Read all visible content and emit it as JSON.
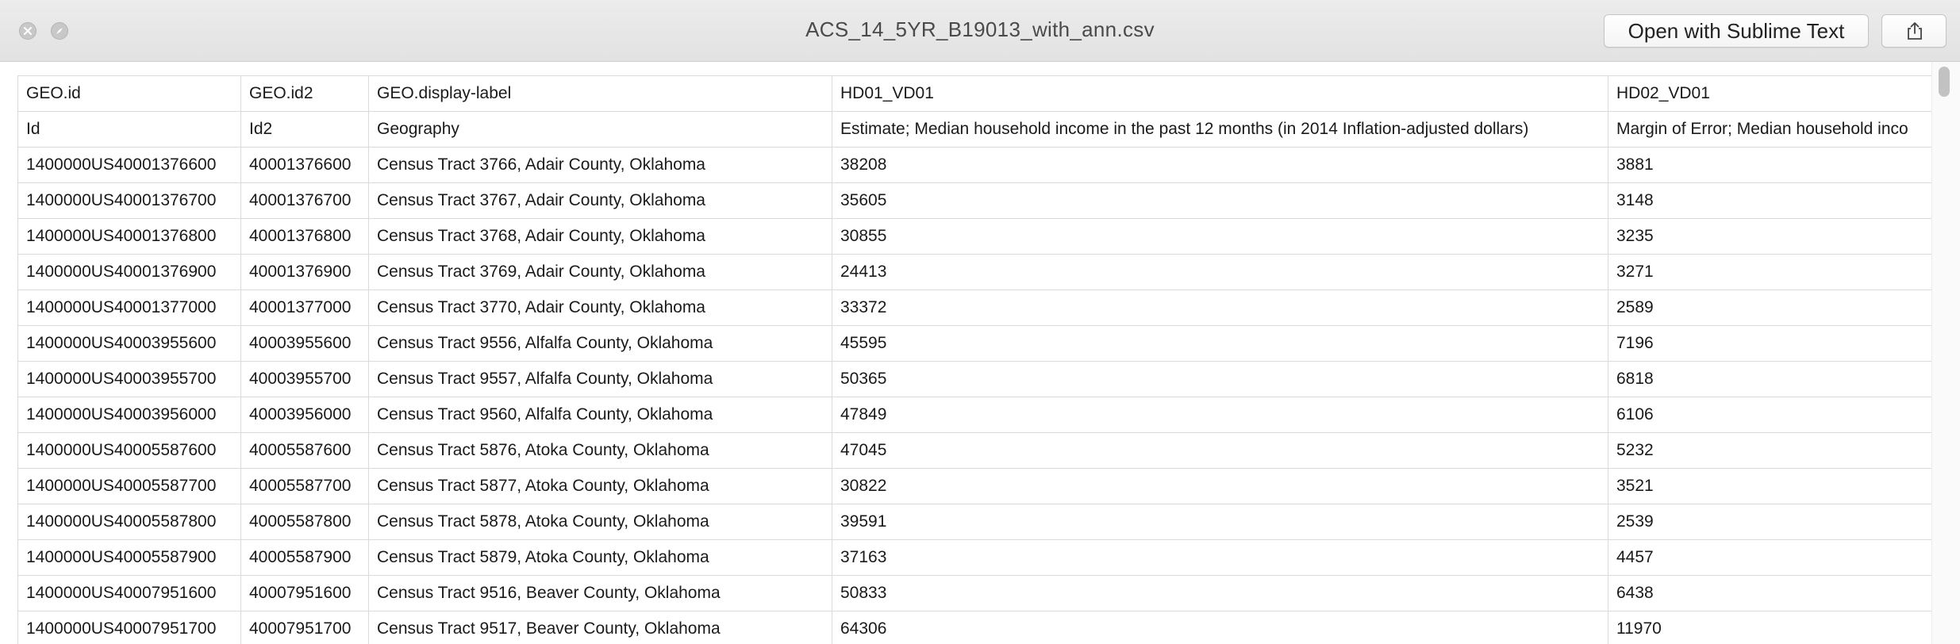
{
  "window": {
    "title": "ACS_14_5YR_B19013_with_ann.csv",
    "open_button_label": "Open with Sublime Text"
  },
  "icons": {
    "close": "close-icon",
    "fullscreen": "fullscreen-icon",
    "share": "share-icon"
  },
  "table": {
    "rows": [
      [
        "GEO.id",
        "GEO.id2",
        "GEO.display-label",
        "HD01_VD01",
        "HD02_VD01"
      ],
      [
        "Id",
        "Id2",
        "Geography",
        "Estimate; Median household income in the past 12 months (in 2014 Inflation-adjusted dollars)",
        "Margin of Error; Median household inco"
      ],
      [
        "1400000US40001376600",
        "40001376600",
        "Census Tract 3766, Adair County, Oklahoma",
        "38208",
        "3881"
      ],
      [
        "1400000US40001376700",
        "40001376700",
        "Census Tract 3767, Adair County, Oklahoma",
        "35605",
        "3148"
      ],
      [
        "1400000US40001376800",
        "40001376800",
        "Census Tract 3768, Adair County, Oklahoma",
        "30855",
        "3235"
      ],
      [
        "1400000US40001376900",
        "40001376900",
        "Census Tract 3769, Adair County, Oklahoma",
        "24413",
        "3271"
      ],
      [
        "1400000US40001377000",
        "40001377000",
        "Census Tract 3770, Adair County, Oklahoma",
        "33372",
        "2589"
      ],
      [
        "1400000US40003955600",
        "40003955600",
        "Census Tract 9556, Alfalfa County, Oklahoma",
        "45595",
        "7196"
      ],
      [
        "1400000US40003955700",
        "40003955700",
        "Census Tract 9557, Alfalfa County, Oklahoma",
        "50365",
        "6818"
      ],
      [
        "1400000US40003956000",
        "40003956000",
        "Census Tract 9560, Alfalfa County, Oklahoma",
        "47849",
        "6106"
      ],
      [
        "1400000US40005587600",
        "40005587600",
        "Census Tract 5876, Atoka County, Oklahoma",
        "47045",
        "5232"
      ],
      [
        "1400000US40005587700",
        "40005587700",
        "Census Tract 5877, Atoka County, Oklahoma",
        "30822",
        "3521"
      ],
      [
        "1400000US40005587800",
        "40005587800",
        "Census Tract 5878, Atoka County, Oklahoma",
        "39591",
        "2539"
      ],
      [
        "1400000US40005587900",
        "40005587900",
        "Census Tract 5879, Atoka County, Oklahoma",
        "37163",
        "4457"
      ],
      [
        "1400000US40007951600",
        "40007951600",
        "Census Tract 9516, Beaver County, Oklahoma",
        "50833",
        "6438"
      ],
      [
        "1400000US40007951700",
        "40007951700",
        "Census Tract 9517, Beaver County, Oklahoma",
        "64306",
        "11970"
      ]
    ]
  }
}
